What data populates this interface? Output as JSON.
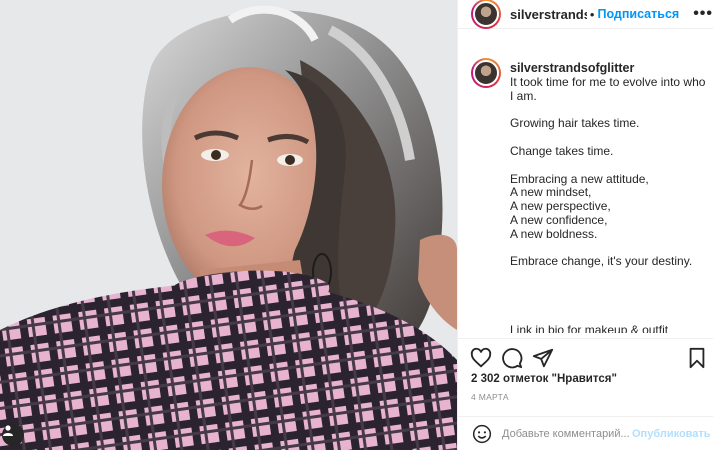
{
  "post": {
    "username": "silverstrandsofglitter",
    "header_username": "silverstrandsofglitt",
    "separator": "•",
    "follow_label": "Подписаться",
    "more_label": "•••"
  },
  "caption": {
    "username": "silverstrandsofglitter",
    "lines": [
      "It took time for me to evolve into who",
      "I am.",
      "",
      "Growing hair takes time.",
      "",
      "Change takes time.",
      "",
      "Embracing a new attitude,",
      "A new mindset,",
      "A new perspective,",
      "A new confidence,",
      "A new boldness.",
      "",
      "Embrace change, it's your destiny.",
      "",
      "",
      "",
      "",
      "Link in bio for makeup & outfit"
    ]
  },
  "stats": {
    "likes": "2 302 отметок \"Нравится\"",
    "date": "4 МАРТА"
  },
  "comment": {
    "placeholder": "Добавьте комментарий...",
    "publish_label": "Опубликовать"
  },
  "icons": [
    "heart-icon",
    "comment-icon",
    "share-icon",
    "bookmark-icon",
    "emoji-icon",
    "user-tag-icon",
    "more-icon"
  ],
  "colors": {
    "link_blue": "#0095f6",
    "publish_disabled": "#b2dffc",
    "border": "#efefef",
    "muted": "#8e8e8e"
  }
}
